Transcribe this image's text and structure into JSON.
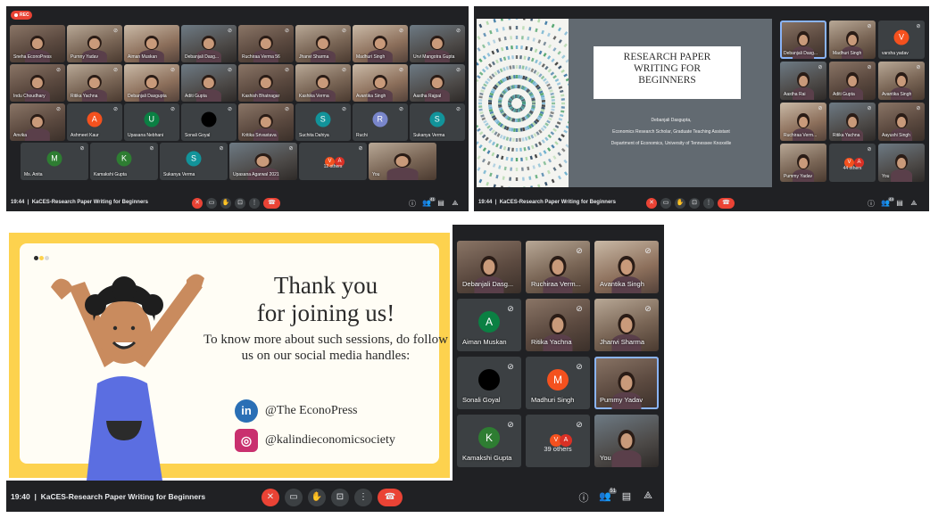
{
  "shot1": {
    "rec_label": "REC",
    "tiles": [
      {
        "name": "Sneha EconoPress"
      },
      {
        "name": "Purnny Yadav"
      },
      {
        "name": "Aiman Muskan"
      },
      {
        "name": "Debanjali Dasg..."
      },
      {
        "name": "Ruchiraa Verma 56"
      },
      {
        "name": "Jhanvi Sharma"
      },
      {
        "name": "Madhuri Singh"
      },
      {
        "name": "Urvi Mangotra Gupta"
      },
      {
        "name": "Indu Choudhary"
      },
      {
        "name": "Ritika Yachna"
      },
      {
        "name": "Debanjali Dasgupta"
      },
      {
        "name": "Aditi Gupta"
      },
      {
        "name": "Kashish Bhatnagar"
      },
      {
        "name": "Kashika Verma"
      },
      {
        "name": "Avantika Singh"
      },
      {
        "name": "Aastha Rajpal"
      },
      {
        "name": "Anvika"
      },
      {
        "name": "Ashmeet Kaur",
        "initial": "A",
        "color": "#f4511e"
      },
      {
        "name": "Upasana Nebhani",
        "initial": "U",
        "color": "#0b8043"
      },
      {
        "name": "Sonali Goyal"
      },
      {
        "name": "Kritika Srivastava"
      },
      {
        "name": "Suchita Dahiya",
        "initial": "S",
        "color": "#12939a"
      },
      {
        "name": "Ruchi",
        "initial": "R",
        "color": "#7986cb"
      },
      {
        "name": "Sukanya Verma",
        "initial": "S",
        "color": "#12939a"
      },
      {
        "name": "Ms. Anita",
        "initial": "M",
        "color": "#2e7d32"
      },
      {
        "name": "Kamakshi Gupta",
        "initial": "K",
        "color": "#2e7d32"
      },
      {
        "name": "Sukanya Verma",
        "initial": "S",
        "color": "#12939a"
      },
      {
        "name": "Upasana Agarwal 2021"
      },
      {
        "name": "12 others"
      },
      {
        "name": "You"
      }
    ],
    "time": "19:44",
    "meeting_title": "KaCES-Research Paper Writing for Beginners",
    "participants_badge": "41"
  },
  "shot2": {
    "slide": {
      "title_lines": [
        "RESEARCH PAPER",
        "WRITING FOR",
        "BEGINNERS"
      ],
      "presenter": "Debanjali Dasgupta,",
      "role": "Economics Research Scholar, Graduate Teaching Assistant",
      "department": "Department of Economics, University of Tennessee Knoxville"
    },
    "tiles": [
      {
        "name": "Debanjali Dasg..."
      },
      {
        "name": "Madhuri Singh"
      },
      {
        "name": "varsha yadav",
        "initial": "V",
        "color": "#f4511e"
      },
      {
        "name": "Aastha Rai"
      },
      {
        "name": "Aditi Gupta"
      },
      {
        "name": "Avantika Singh"
      },
      {
        "name": "Ruchiraa Verm..."
      },
      {
        "name": "Ritika Yachna"
      },
      {
        "name": "Aayushi Singh"
      },
      {
        "name": "Pummy Yadav"
      },
      {
        "name": "44 others"
      },
      {
        "name": "You"
      }
    ],
    "time": "19:44",
    "meeting_title": "KaCES-Research Paper Writing for Beginners",
    "participants_badge": "44"
  },
  "shot3": {
    "slide": {
      "title_line1": "Thank you",
      "title_line2": "for joining us!",
      "body": "To know more about such sessions, do follow us on our social media handles:",
      "linkedin_icon": "in",
      "linkedin": "@The EconoPress",
      "instagram_icon": "◎",
      "instagram": "@kalindieconomicsociety"
    },
    "tiles": [
      {
        "name": "Debanjali Dasg..."
      },
      {
        "name": "Ruchiraa Verm..."
      },
      {
        "name": "Avantika Singh"
      },
      {
        "name": "Aiman Muskan",
        "initial": "A",
        "color": "#0b8043"
      },
      {
        "name": "Ritika Yachna"
      },
      {
        "name": "Jhanvi Sharma"
      },
      {
        "name": "Sonali Goyal"
      },
      {
        "name": "Madhuri Singh",
        "initial": "M",
        "color": "#f4511e"
      },
      {
        "name": "Pummy Yadav"
      },
      {
        "name": "Kamakshi Gupta",
        "initial": "K",
        "color": "#2e7d32"
      },
      {
        "name": "39 others"
      },
      {
        "name": "You"
      }
    ],
    "time": "19:40",
    "meeting_title": "KaCES-Research Paper Writing for Beginners",
    "participants_badge": "51"
  },
  "icons": {
    "mic_off": "mic-off-icon",
    "camera": "camera-icon",
    "raise_hand": "raise-hand-icon",
    "present": "present-screen-icon",
    "more": "more-options-icon",
    "hang_up": "hang-up-icon",
    "info": "info-icon",
    "people": "people-icon",
    "chat": "chat-icon",
    "activities": "activities-icon"
  }
}
